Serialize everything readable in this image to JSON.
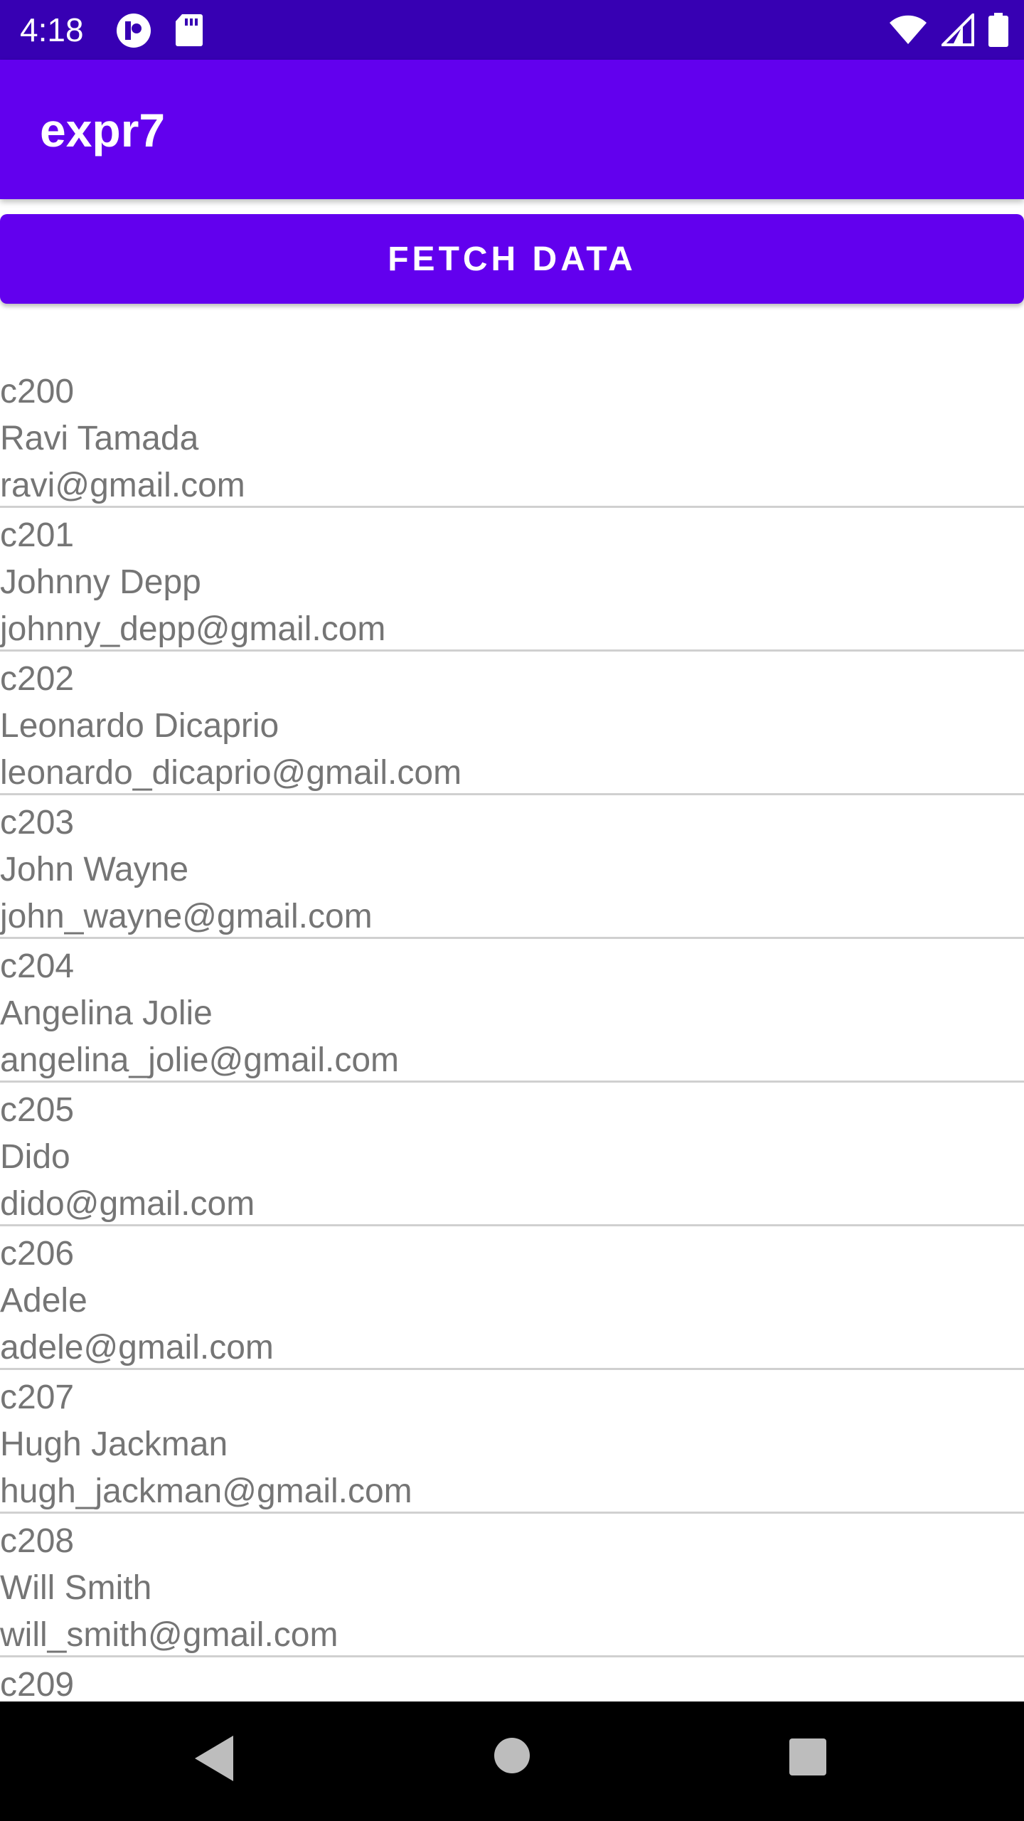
{
  "status_bar": {
    "time": "4:18",
    "left_icons": [
      "app-notification-icon",
      "sd-card-icon"
    ],
    "right_icons": [
      "wifi-icon",
      "signal-icon",
      "battery-icon"
    ],
    "background": "#3700b3"
  },
  "app_bar": {
    "title": "expr7",
    "background": "#6200ee"
  },
  "fetch_button": {
    "label": "FETCH DATA",
    "background": "#6200ee"
  },
  "contacts": [
    {
      "id": "c200",
      "name": "Ravi Tamada",
      "email": "ravi@gmail.com"
    },
    {
      "id": "c201",
      "name": "Johnny Depp",
      "email": "johnny_depp@gmail.com"
    },
    {
      "id": "c202",
      "name": "Leonardo Dicaprio",
      "email": "leonardo_dicaprio@gmail.com"
    },
    {
      "id": "c203",
      "name": "John Wayne",
      "email": "john_wayne@gmail.com"
    },
    {
      "id": "c204",
      "name": "Angelina Jolie",
      "email": "angelina_jolie@gmail.com"
    },
    {
      "id": "c205",
      "name": "Dido",
      "email": "dido@gmail.com"
    },
    {
      "id": "c206",
      "name": "Adele",
      "email": "adele@gmail.com"
    },
    {
      "id": "c207",
      "name": "Hugh Jackman",
      "email": "hugh_jackman@gmail.com"
    },
    {
      "id": "c208",
      "name": "Will Smith",
      "email": "will_smith@gmail.com"
    },
    {
      "id": "c209",
      "name": "",
      "email": ""
    }
  ],
  "nav_bar": {
    "buttons": [
      "back-icon",
      "home-icon",
      "recents-icon"
    ]
  }
}
